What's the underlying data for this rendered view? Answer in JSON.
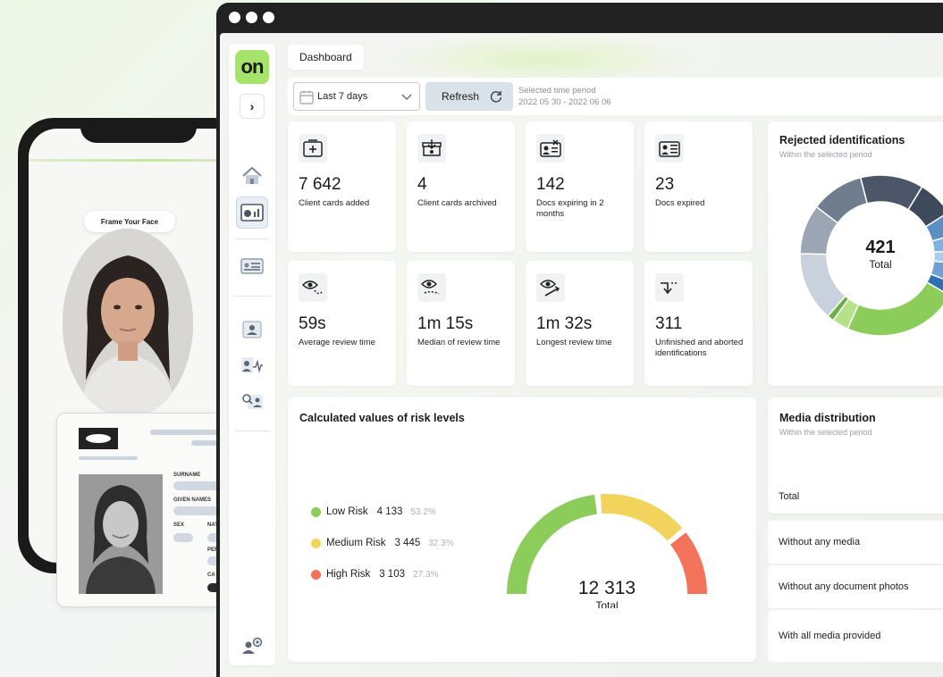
{
  "phone": {
    "frame_prompt": "Frame Your Face"
  },
  "id_card": {
    "labels": [
      "SURNAME",
      "GIVEN NAMES",
      "SEX",
      "NAT",
      "PER",
      "CA"
    ]
  },
  "sidebar": {
    "logo": "on",
    "expand_glyph": "›"
  },
  "header": {
    "breadcrumb": "Dashboard"
  },
  "toolbar": {
    "period_value": "Last 7 days",
    "refresh_label": "Refresh",
    "period_caption": "Selected time period",
    "period_range": "2022 05 30 - 2022 06 06"
  },
  "stats": [
    {
      "value": "7 642",
      "label": "Client cards added",
      "icon": "add-card-icon"
    },
    {
      "value": "4",
      "label": "Client cards archived",
      "icon": "archive-icon"
    },
    {
      "value": "142",
      "label": "Docs expiring in 2 months",
      "icon": "id-expiring-icon"
    },
    {
      "value": "23",
      "label": "Docs expired",
      "icon": "id-expired-icon"
    },
    {
      "value": "59s",
      "label": "Average review time",
      "icon": "eye-review-icon"
    },
    {
      "value": "1m 15s",
      "label": "Median of review time",
      "icon": "eye-median-icon"
    },
    {
      "value": "1m 32s",
      "label": "Longest review time",
      "icon": "eye-longest-icon"
    },
    {
      "value": "311",
      "label": "Unfinished and aborted identifications",
      "icon": "aborted-icon"
    }
  ],
  "rejected": {
    "title": "Rejected identifications",
    "subtitle": "Within the selected period",
    "total_value": "421",
    "total_label": "Total"
  },
  "risk": {
    "title": "Calculated values of risk levels",
    "total_value": "12 313",
    "total_label": "Total",
    "items": [
      {
        "label": "Low Risk",
        "value": "4 133",
        "pct": "53.2%",
        "color": "#8ccc5a"
      },
      {
        "label": "Medium Risk",
        "value": "3 445",
        "pct": "32.3%",
        "color": "#f2d35c"
      },
      {
        "label": "High Risk",
        "value": "3 103",
        "pct": "27.3%",
        "color": "#f2735a"
      }
    ]
  },
  "media": {
    "title": "Media distribution",
    "subtitle": "Within the selected period",
    "rows": [
      "Total",
      "Without any media",
      "Without any document photos",
      "With all media provided"
    ]
  },
  "colors": {
    "accent": "#a6e36a",
    "navy": "#3d4a5c"
  }
}
